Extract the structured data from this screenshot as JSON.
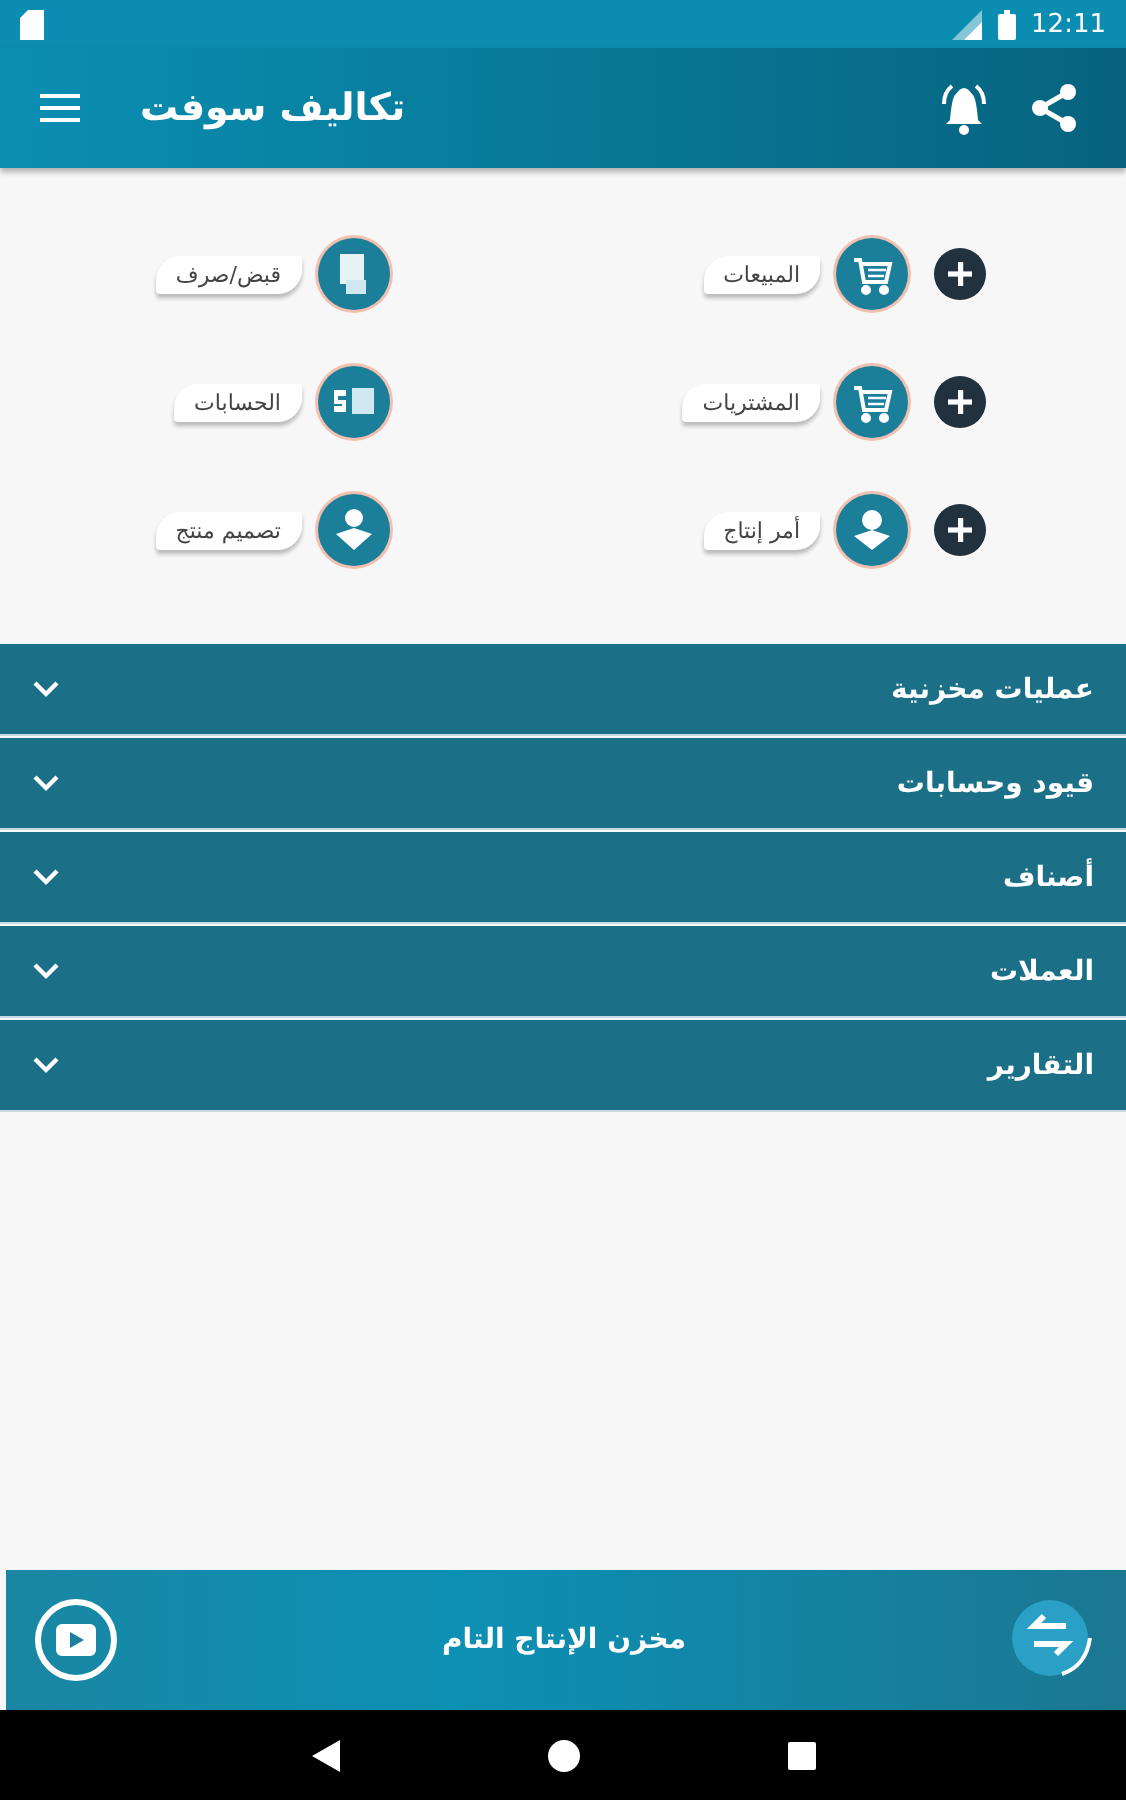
{
  "status_bar": {
    "time": "12:11"
  },
  "app_bar": {
    "title": "تكاليف سوفت"
  },
  "shortcuts": [
    {
      "label": "المبيعات",
      "add_button": true
    },
    {
      "label": "قبض/صرف",
      "add_button": false
    },
    {
      "label": "المشتريات",
      "add_button": true
    },
    {
      "label": "الحسابات",
      "add_button": false
    },
    {
      "label": "أمر إنتاج",
      "add_button": true
    },
    {
      "label": "تصميم منتج",
      "add_button": false
    }
  ],
  "sections": [
    {
      "label": "عمليات مخزنية",
      "expanded": false
    },
    {
      "label": "قيود وحسابات",
      "expanded": false
    },
    {
      "label": "أصناف",
      "expanded": false
    },
    {
      "label": "العملات",
      "expanded": false
    },
    {
      "label": "التقارير",
      "expanded": false
    }
  ],
  "footer": {
    "text": "مخزن الإنتاج التام"
  }
}
